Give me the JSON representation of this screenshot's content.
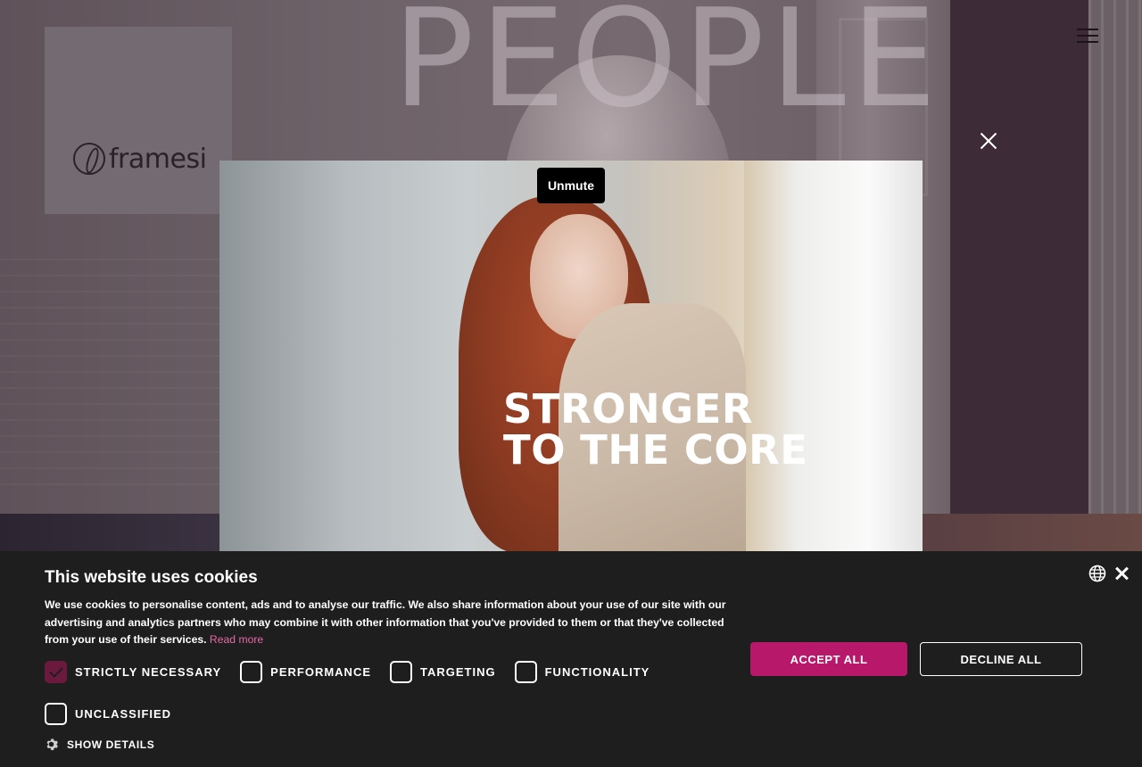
{
  "hero": {
    "background_word": "PEOPLE"
  },
  "brand": {
    "logo_text": "framesi"
  },
  "header": {
    "menu_icon": "hamburger-menu-icon"
  },
  "modal": {
    "close_icon": "close-icon",
    "video": {
      "headline_line1": "STRONGER",
      "headline_line2": "TO THE CORE",
      "unmute_label": "Unmute"
    }
  },
  "cookie_banner": {
    "title": "This website uses cookies",
    "body": "We use cookies to personalise content, ads and to analyse our traffic. We also share information about your use of our site with our advertising and analytics partners who may combine it with other information that you've provided to them or that they've collected from your use of their services.",
    "read_more": "Read more",
    "categories": [
      {
        "label": "STRICTLY NECESSARY",
        "checked": true
      },
      {
        "label": "PERFORMANCE",
        "checked": false
      },
      {
        "label": "TARGETING",
        "checked": false
      },
      {
        "label": "FUNCTIONALITY",
        "checked": false
      },
      {
        "label": "UNCLASSIFIED",
        "checked": false
      }
    ],
    "show_details": "SHOW DETAILS",
    "accept_all": "ACCEPT ALL",
    "decline_all": "DECLINE ALL",
    "language_icon": "globe-icon",
    "close_icon": "close-icon"
  },
  "colors": {
    "accent": "#b8186a",
    "link": "#e46aa6",
    "banner_bg": "#1e1e1e"
  }
}
